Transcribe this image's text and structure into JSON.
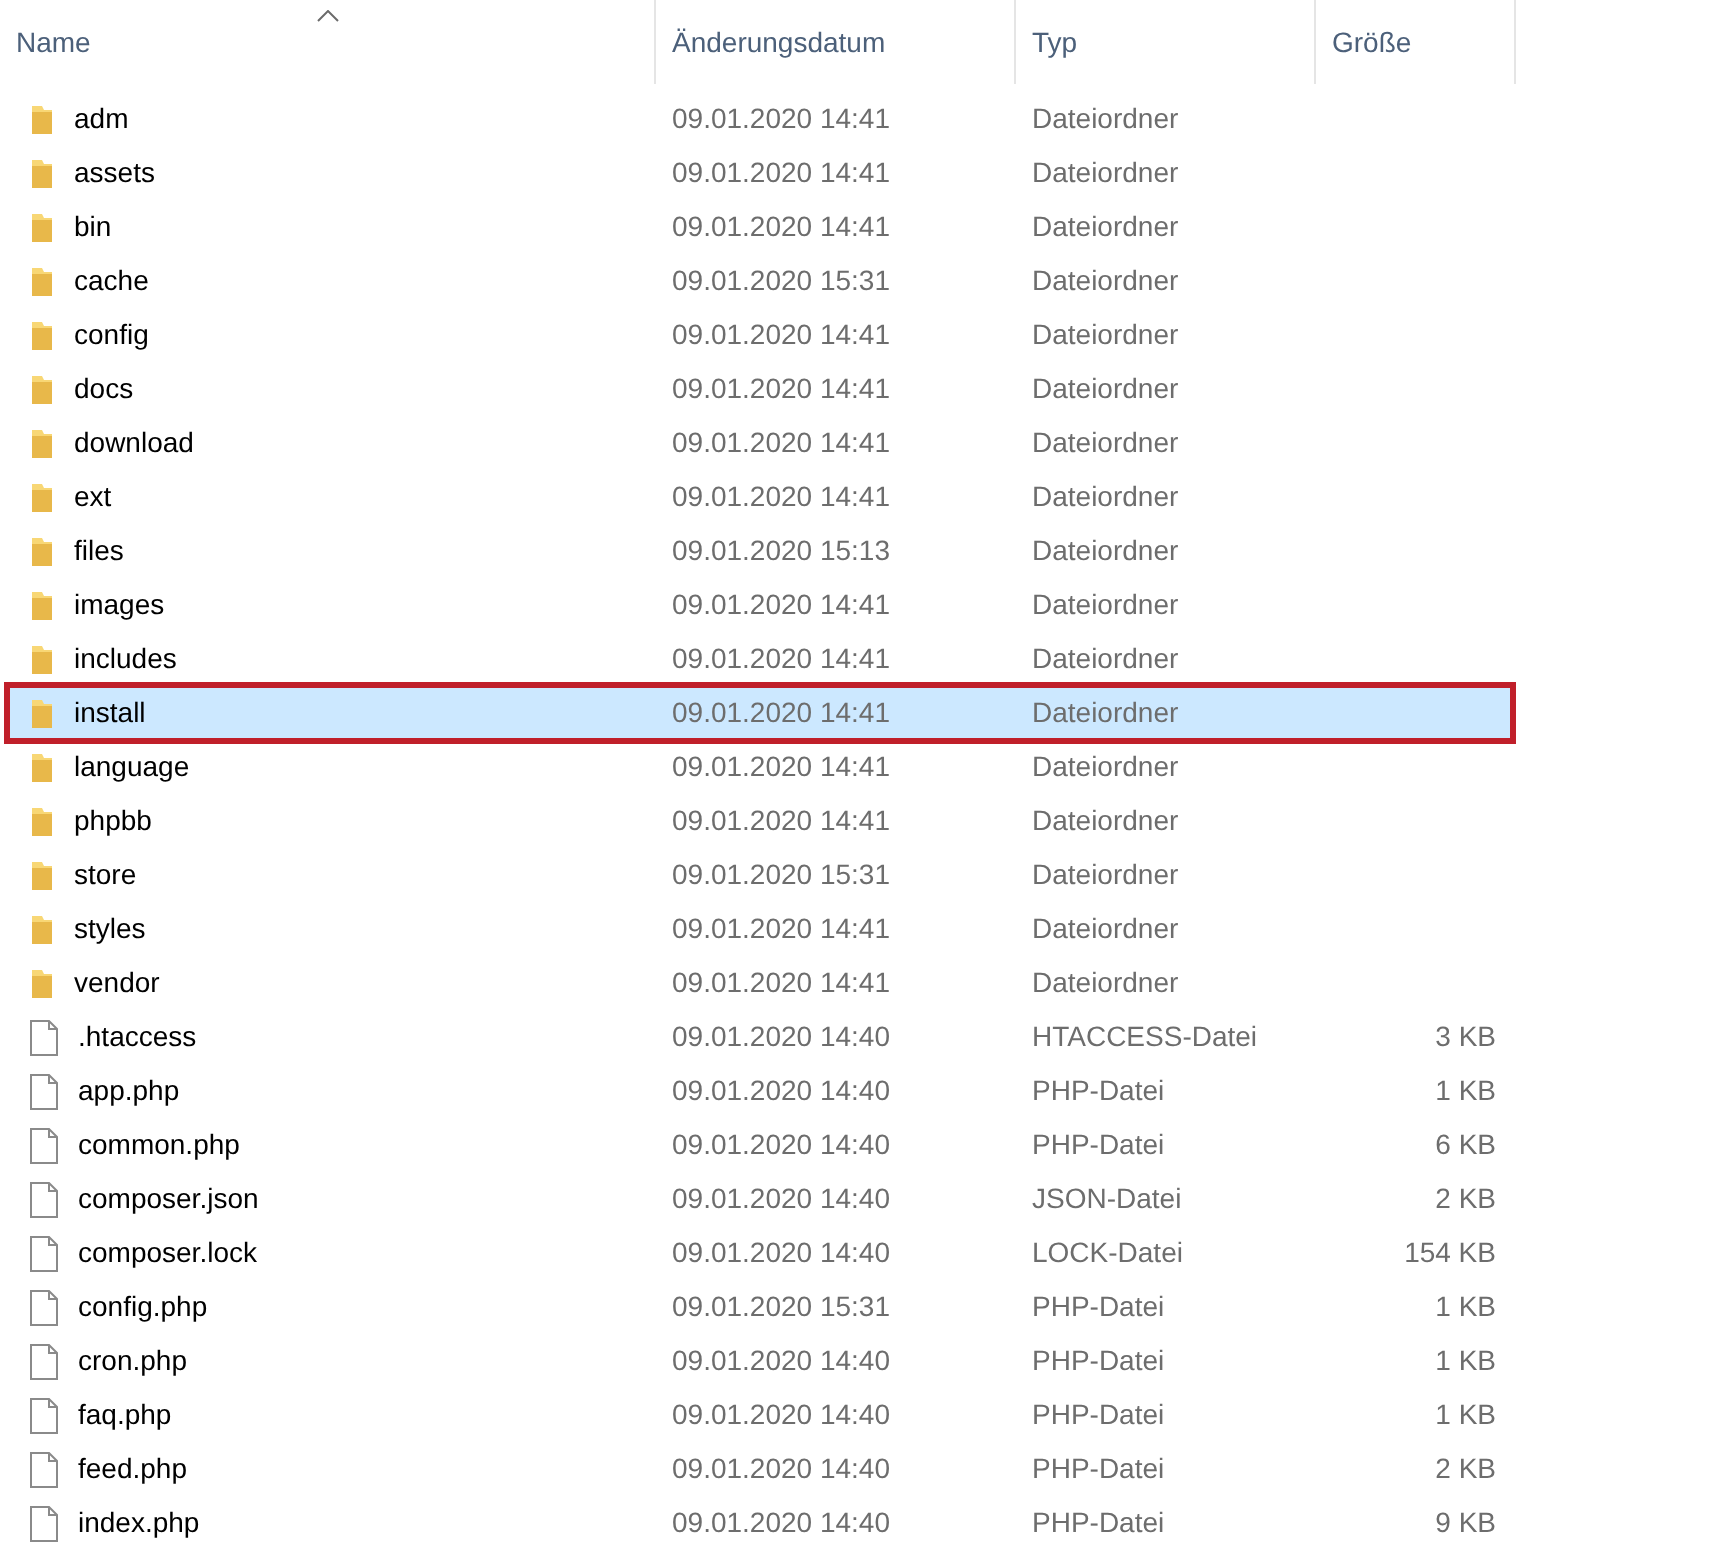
{
  "columns": [
    {
      "label": "Name",
      "sorted": true
    },
    {
      "label": "Änderungsdatum",
      "sorted": false
    },
    {
      "label": "Typ",
      "sorted": false
    },
    {
      "label": "Größe",
      "sorted": false
    }
  ],
  "rows": [
    {
      "kind": "folder",
      "name": "adm",
      "date": "09.01.2020 14:41",
      "type": "Dateiordner",
      "selected": false
    },
    {
      "kind": "folder",
      "name": "assets",
      "date": "09.01.2020 14:41",
      "type": "Dateiordner",
      "selected": false
    },
    {
      "kind": "folder",
      "name": "bin",
      "date": "09.01.2020 14:41",
      "type": "Dateiordner",
      "selected": false
    },
    {
      "kind": "folder",
      "name": "cache",
      "date": "09.01.2020 15:31",
      "type": "Dateiordner",
      "selected": false
    },
    {
      "kind": "folder",
      "name": "config",
      "date": "09.01.2020 14:41",
      "type": "Dateiordner",
      "selected": false
    },
    {
      "kind": "folder",
      "name": "docs",
      "date": "09.01.2020 14:41",
      "type": "Dateiordner",
      "selected": false
    },
    {
      "kind": "folder",
      "name": "download",
      "date": "09.01.2020 14:41",
      "type": "Dateiordner",
      "selected": false
    },
    {
      "kind": "folder",
      "name": "ext",
      "date": "09.01.2020 14:41",
      "type": "Dateiordner",
      "selected": false
    },
    {
      "kind": "folder",
      "name": "files",
      "date": "09.01.2020 15:13",
      "type": "Dateiordner",
      "selected": false
    },
    {
      "kind": "folder",
      "name": "images",
      "date": "09.01.2020 14:41",
      "type": "Dateiordner",
      "selected": false
    },
    {
      "kind": "folder",
      "name": "includes",
      "date": "09.01.2020 14:41",
      "type": "Dateiordner",
      "selected": false
    },
    {
      "kind": "folder",
      "name": "install",
      "date": "09.01.2020 14:41",
      "type": "Dateiordner",
      "selected": true
    },
    {
      "kind": "folder",
      "name": "language",
      "date": "09.01.2020 14:41",
      "type": "Dateiordner",
      "selected": false
    },
    {
      "kind": "folder",
      "name": "phpbb",
      "date": "09.01.2020 14:41",
      "type": "Dateiordner",
      "selected": false
    },
    {
      "kind": "folder",
      "name": "store",
      "date": "09.01.2020 15:31",
      "type": "Dateiordner",
      "selected": false
    },
    {
      "kind": "folder",
      "name": "styles",
      "date": "09.01.2020 14:41",
      "type": "Dateiordner",
      "selected": false
    },
    {
      "kind": "folder",
      "name": "vendor",
      "date": "09.01.2020 14:41",
      "type": "Dateiordner",
      "selected": false
    },
    {
      "kind": "file",
      "name": ".htaccess",
      "date": "09.01.2020 14:40",
      "type": "HTACCESS-Datei",
      "size": "3 KB",
      "selected": false
    },
    {
      "kind": "file",
      "name": "app.php",
      "date": "09.01.2020 14:40",
      "type": "PHP-Datei",
      "size": "1 KB",
      "selected": false
    },
    {
      "kind": "file",
      "name": "common.php",
      "date": "09.01.2020 14:40",
      "type": "PHP-Datei",
      "size": "6 KB",
      "selected": false
    },
    {
      "kind": "file",
      "name": "composer.json",
      "date": "09.01.2020 14:40",
      "type": "JSON-Datei",
      "size": "2 KB",
      "selected": false
    },
    {
      "kind": "file",
      "name": "composer.lock",
      "date": "09.01.2020 14:40",
      "type": "LOCK-Datei",
      "size": "154 KB",
      "selected": false
    },
    {
      "kind": "file",
      "name": "config.php",
      "date": "09.01.2020 15:31",
      "type": "PHP-Datei",
      "size": "1 KB",
      "selected": false
    },
    {
      "kind": "file",
      "name": "cron.php",
      "date": "09.01.2020 14:40",
      "type": "PHP-Datei",
      "size": "1 KB",
      "selected": false
    },
    {
      "kind": "file",
      "name": "faq.php",
      "date": "09.01.2020 14:40",
      "type": "PHP-Datei",
      "size": "1 KB",
      "selected": false
    },
    {
      "kind": "file",
      "name": "feed.php",
      "date": "09.01.2020 14:40",
      "type": "PHP-Datei",
      "size": "2 KB",
      "selected": false
    },
    {
      "kind": "file",
      "name": "index.php",
      "date": "09.01.2020 14:40",
      "type": "PHP-Datei",
      "size": "9 KB",
      "selected": false
    }
  ]
}
